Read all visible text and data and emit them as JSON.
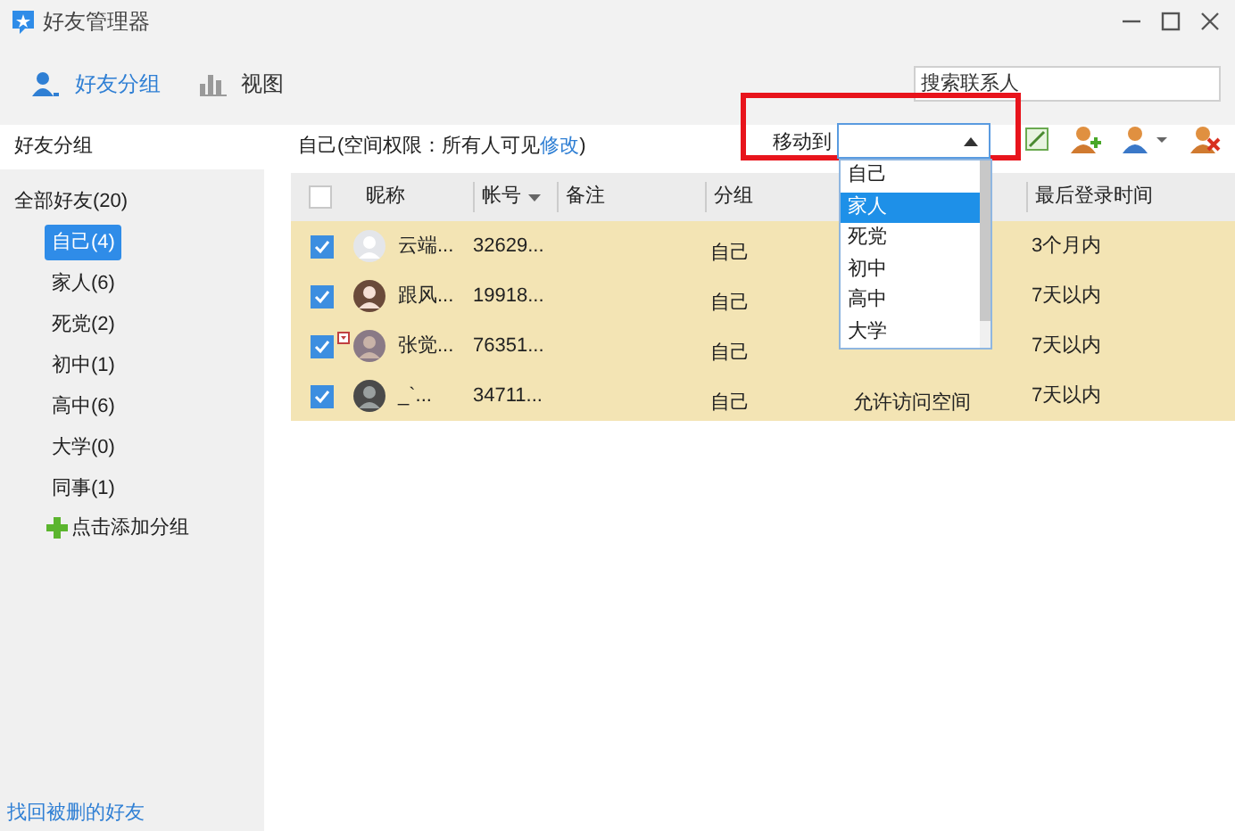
{
  "window": {
    "title": "好友管理器"
  },
  "toolbar": {
    "tabs": [
      {
        "label": "好友分组",
        "selected": true,
        "kind": "people"
      },
      {
        "label": "视图",
        "selected": false,
        "kind": "chart"
      }
    ],
    "search": {
      "placeholder": "搜索联系人"
    }
  },
  "sidebar": {
    "title": "好友分组",
    "all": "全部好友(20)",
    "groups": [
      {
        "label": "自己(4)",
        "selected": true
      },
      {
        "label": "家人(6)",
        "selected": false
      },
      {
        "label": "死党(2)",
        "selected": false
      },
      {
        "label": "初中(1)",
        "selected": false
      },
      {
        "label": "高中(6)",
        "selected": false
      },
      {
        "label": "大学(0)",
        "selected": false
      },
      {
        "label": "同事(1)",
        "selected": false
      }
    ],
    "add": "点击添加分组",
    "footer_link": "找回被删的好友"
  },
  "content": {
    "header_prefix": "自己(空间权限：所有人可见",
    "header_link": "修改",
    "header_suffix": ")",
    "move_label": "移动到",
    "dropdown": {
      "expanded": true,
      "options": [
        {
          "label": "自己",
          "selected": false
        },
        {
          "label": "家人",
          "selected": true
        },
        {
          "label": "死党",
          "selected": false
        },
        {
          "label": "初中",
          "selected": false
        },
        {
          "label": "高中",
          "selected": false
        },
        {
          "label": "大学",
          "selected": false
        }
      ]
    }
  },
  "table": {
    "select_all": false,
    "columns": [
      "昵称",
      "帐号",
      "备注",
      "分组",
      "最后登录时间"
    ],
    "rows": [
      {
        "checked": true,
        "flag": false,
        "kind": "blank",
        "nickname": "云端...",
        "account": "32629...",
        "group": "自己",
        "last_login": "3个月内"
      },
      {
        "checked": true,
        "flag": false,
        "kind": "girl",
        "nickname": "跟风...",
        "account": "19918...",
        "group": "自己",
        "last_login": "7天以内"
      },
      {
        "checked": true,
        "flag": true,
        "kind": "photo",
        "nickname": "张觉...",
        "account": "76351...",
        "group": "自己",
        "last_login": "7天以内"
      },
      {
        "checked": true,
        "flag": false,
        "kind": "dark",
        "nickname": "_`...",
        "account": "34711...",
        "group": "自己",
        "column_5": "允许访问空间",
        "last_login": "7天以内"
      }
    ]
  }
}
